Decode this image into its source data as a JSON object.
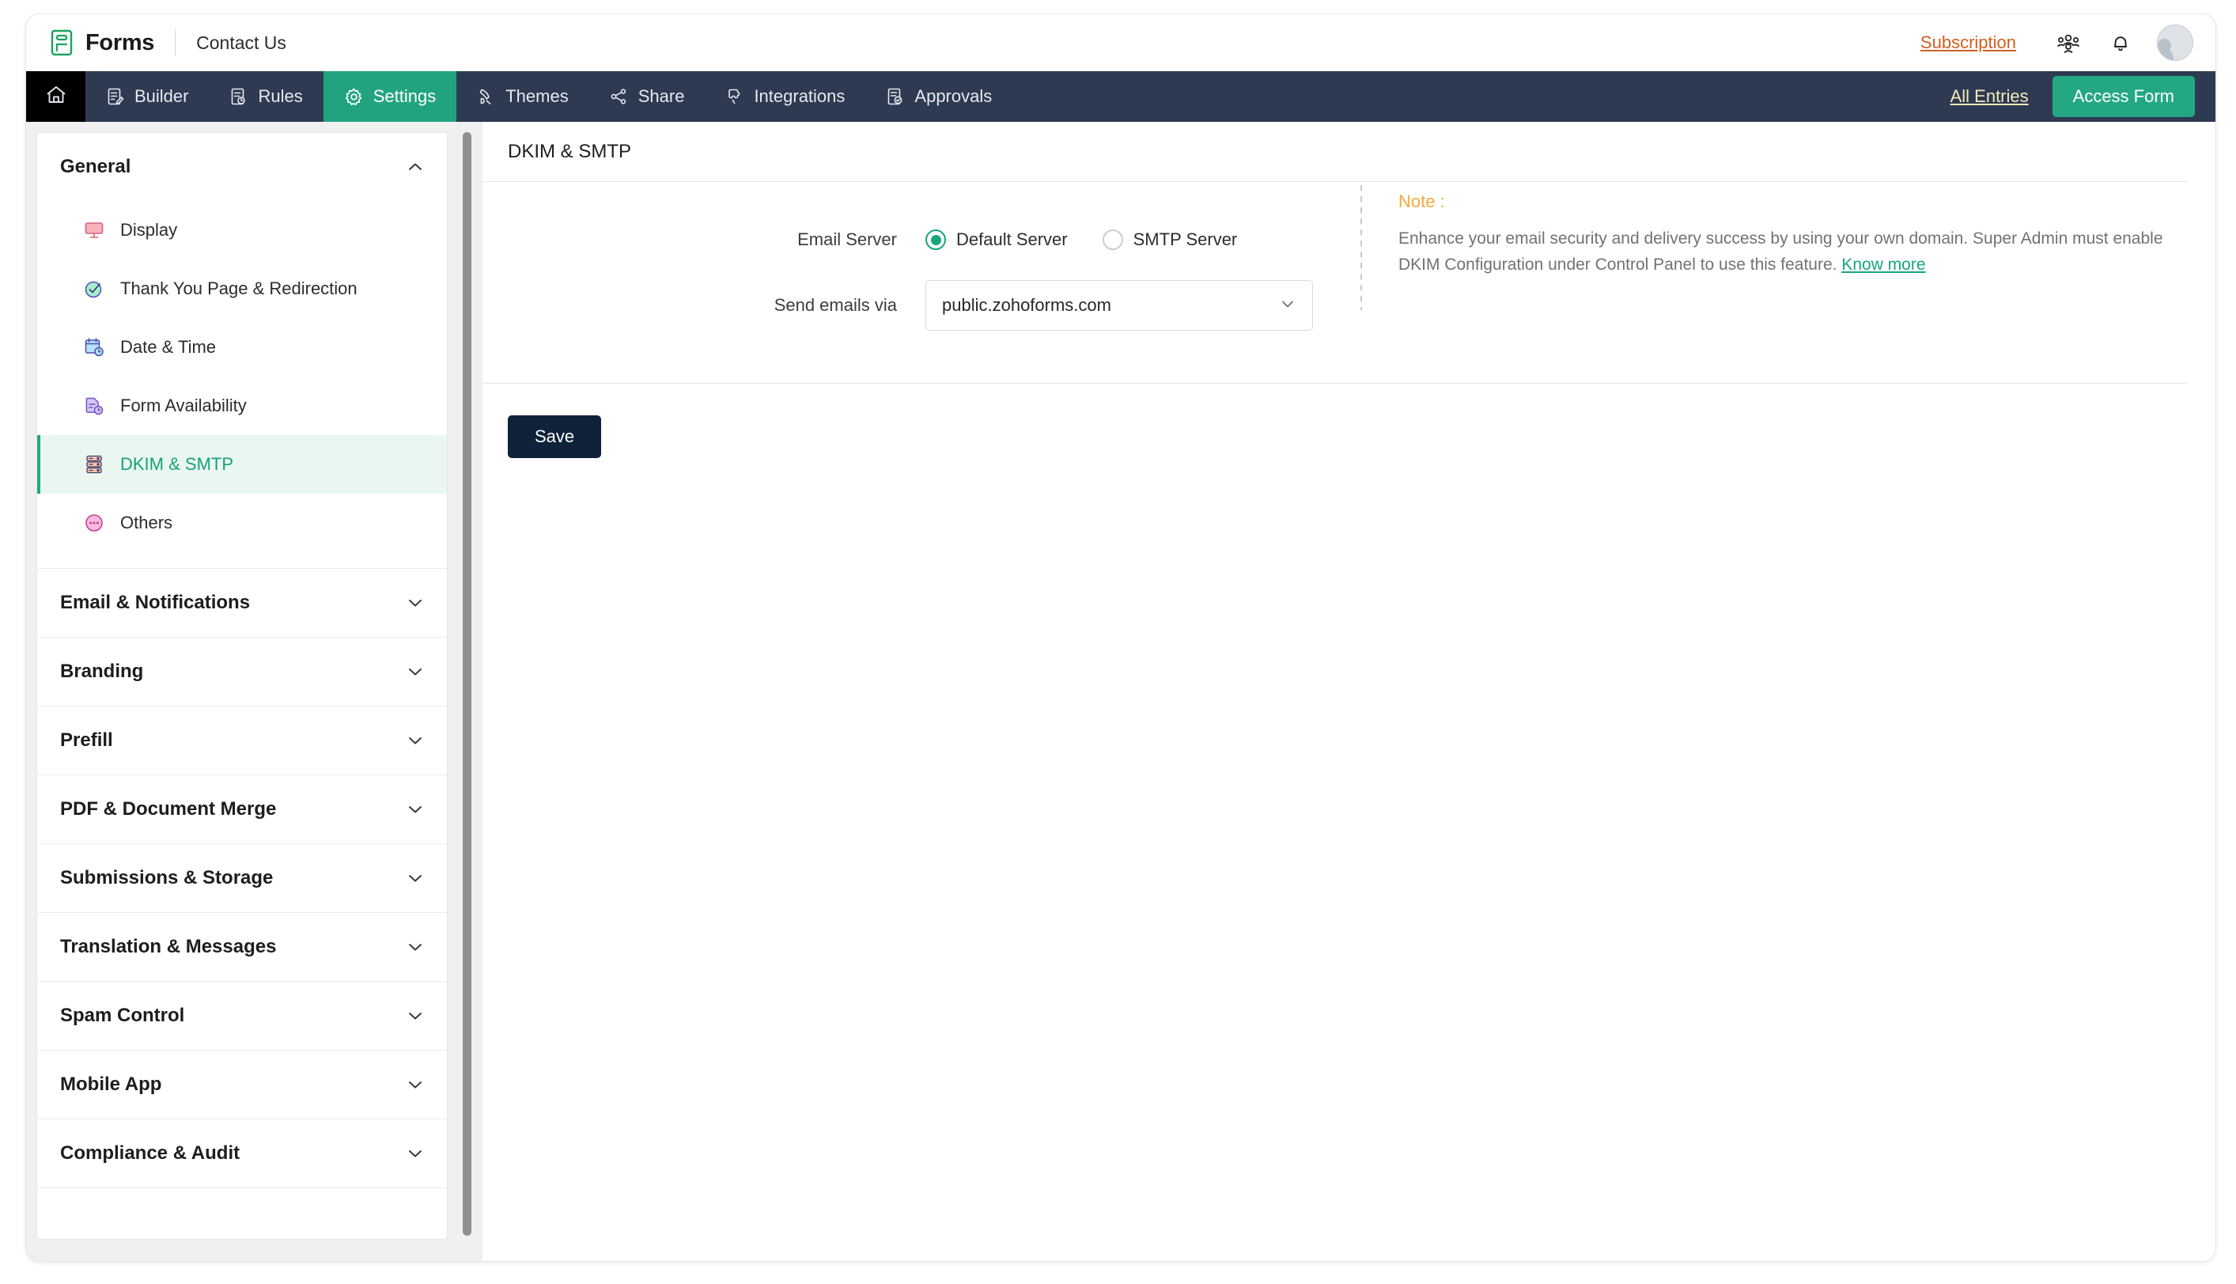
{
  "header": {
    "brand_name": "Forms",
    "brand_icon": "forms-logo-icon",
    "breadcrumb_title": "Contact Us",
    "subscription_label": "Subscription",
    "users_icon": "users-group-icon",
    "bell_icon": "notification-bell-icon",
    "avatar_icon": "user-avatar"
  },
  "nav": {
    "home_icon": "home-icon",
    "tabs": [
      {
        "label": "Builder",
        "icon": "builder-icon",
        "active": false
      },
      {
        "label": "Rules",
        "icon": "rules-icon",
        "active": false
      },
      {
        "label": "Settings",
        "icon": "gear-icon",
        "active": true
      },
      {
        "label": "Themes",
        "icon": "themes-brush-icon",
        "active": false
      },
      {
        "label": "Share",
        "icon": "share-icon",
        "active": false
      },
      {
        "label": "Integrations",
        "icon": "integrations-puzzle-icon",
        "active": false
      },
      {
        "label": "Approvals",
        "icon": "approvals-icon",
        "active": false
      }
    ],
    "all_entries_label": "All Entries",
    "access_form_label": "Access Form"
  },
  "sidebar": {
    "sections": [
      {
        "title": "General",
        "expanded": true,
        "chevron": "chevron-up-icon",
        "items": [
          {
            "label": "Display",
            "icon": "display-monitor-icon",
            "active": false
          },
          {
            "label": "Thank You Page & Redirection",
            "icon": "check-circle-icon",
            "active": false
          },
          {
            "label": "Date & Time",
            "icon": "calendar-clock-icon",
            "active": false
          },
          {
            "label": "Form Availability",
            "icon": "document-clock-icon",
            "active": false
          },
          {
            "label": "DKIM & SMTP",
            "icon": "server-rack-icon",
            "active": true
          },
          {
            "label": "Others",
            "icon": "ellipsis-circle-icon",
            "active": false
          }
        ]
      },
      {
        "title": "Email & Notifications",
        "expanded": false,
        "chevron": "chevron-down-icon",
        "items": []
      },
      {
        "title": "Branding",
        "expanded": false,
        "chevron": "chevron-down-icon",
        "items": []
      },
      {
        "title": "Prefill",
        "expanded": false,
        "chevron": "chevron-down-icon",
        "items": []
      },
      {
        "title": "PDF & Document Merge",
        "expanded": false,
        "chevron": "chevron-down-icon",
        "items": []
      },
      {
        "title": "Submissions & Storage",
        "expanded": false,
        "chevron": "chevron-down-icon",
        "items": []
      },
      {
        "title": "Translation & Messages",
        "expanded": false,
        "chevron": "chevron-down-icon",
        "items": []
      },
      {
        "title": "Spam Control",
        "expanded": false,
        "chevron": "chevron-down-icon",
        "items": []
      },
      {
        "title": "Mobile App",
        "expanded": false,
        "chevron": "chevron-down-icon",
        "items": []
      },
      {
        "title": "Compliance & Audit",
        "expanded": false,
        "chevron": "chevron-down-icon",
        "items": []
      }
    ]
  },
  "main": {
    "title": "DKIM & SMTP",
    "email_server": {
      "label": "Email Server",
      "options": [
        {
          "label": "Default Server",
          "selected": true
        },
        {
          "label": "SMTP Server",
          "selected": false
        }
      ]
    },
    "send_emails_via": {
      "label": "Send emails via",
      "value": "public.zohoforms.com",
      "chevron": "chevron-down-icon"
    },
    "note": {
      "heading": "Note :",
      "text": "Enhance your email security and delivery success by using your own domain. Super Admin must enable DKIM Configuration under Control Panel to use this feature.",
      "link_label": "Know more"
    },
    "save_label": "Save"
  },
  "colors": {
    "accent_green": "#22a37f",
    "nav_bg": "#2e3a52",
    "subscription_orange": "#d25e20",
    "note_orange": "#f2a93b",
    "save_dark": "#10223a",
    "all_entries_yellow": "#f3e9b8"
  }
}
